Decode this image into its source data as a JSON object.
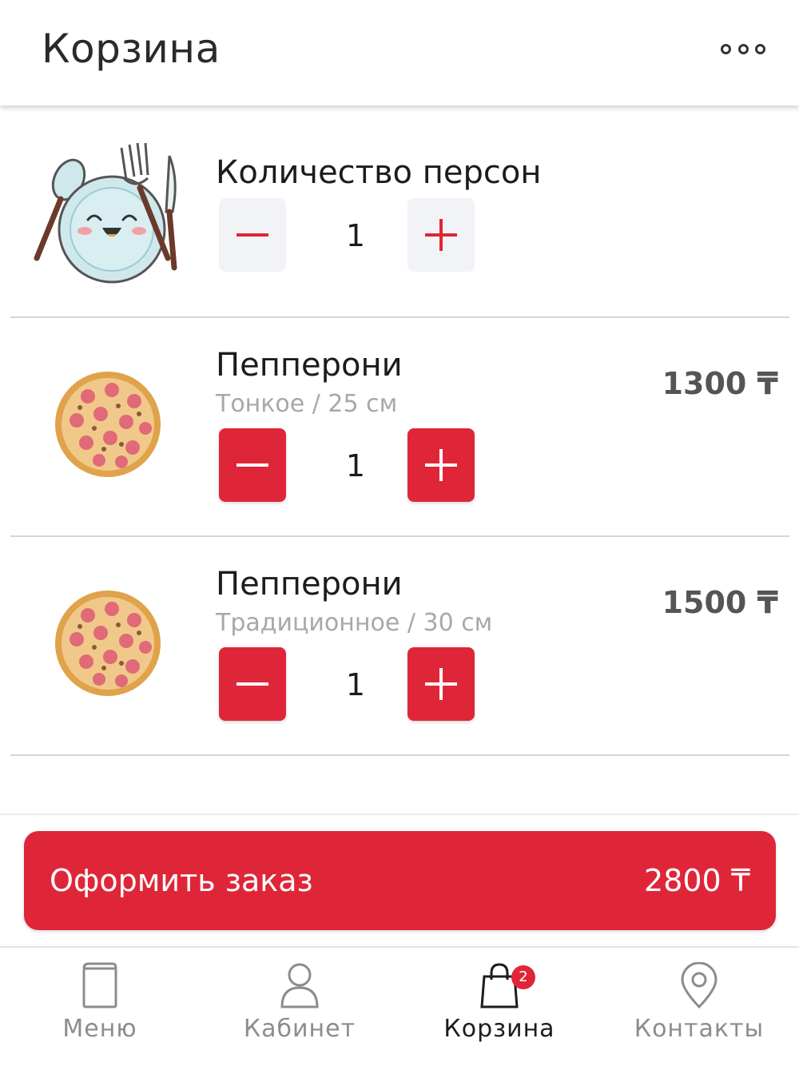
{
  "header": {
    "title": "Корзина",
    "more_icon": "more-horizontal-icon"
  },
  "persons": {
    "title": "Количество персон",
    "quantity": "1",
    "icon": "plate-cutlery-mascot"
  },
  "cart_items": [
    {
      "name": "Пепперони",
      "options": "Тонкое / 25 см",
      "quantity": "1",
      "price": "1300 ₸"
    },
    {
      "name": "Пепперони",
      "options": "Традиционное / 30 см",
      "quantity": "1",
      "price": "1500 ₸"
    }
  ],
  "checkout": {
    "label": "Оформить заказ",
    "total": "2800 ₸"
  },
  "tabbar": {
    "items": [
      {
        "label": "Меню",
        "icon": "menu-book-icon"
      },
      {
        "label": "Кабинет",
        "icon": "user-icon"
      },
      {
        "label": "Корзина",
        "icon": "shopping-bag-icon",
        "badge": "2",
        "active": true
      },
      {
        "label": "Контакты",
        "icon": "location-pin-icon"
      }
    ]
  },
  "colors": {
    "accent": "#df2638",
    "text": "#1c1c1c",
    "muted": "#a8a8a8",
    "price": "#555555"
  }
}
